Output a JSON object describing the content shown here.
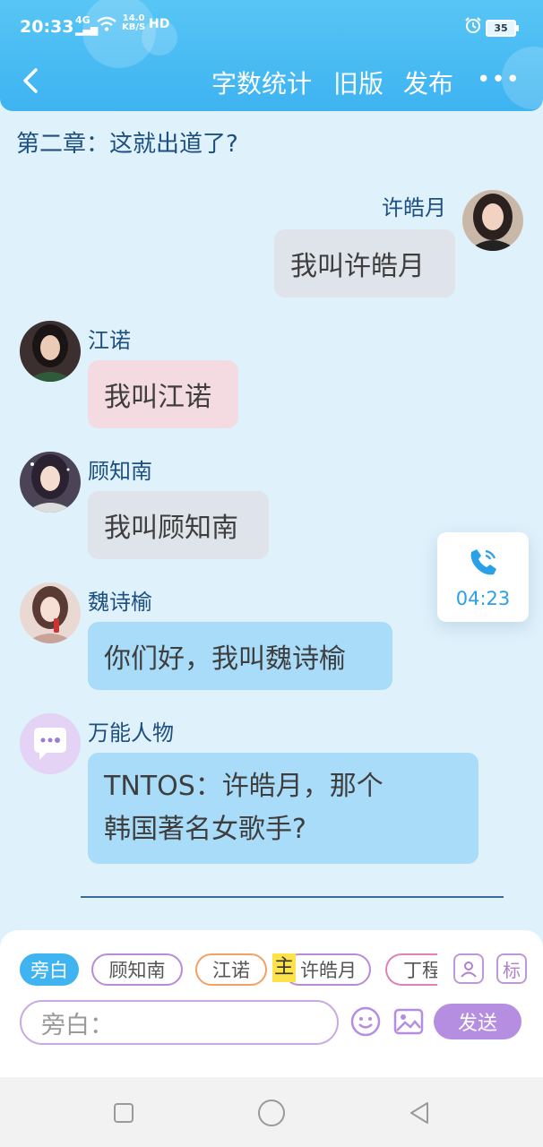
{
  "status_bar": {
    "time": "20:33",
    "signal": "4G",
    "speed_value": "14.0",
    "speed_unit": "KB/S",
    "hd": "HD",
    "battery": "35"
  },
  "header": {
    "back_icon": "chevron-left-icon",
    "actions": [
      "字数统计",
      "旧版",
      "发布"
    ],
    "more": "•••"
  },
  "chapter_title": "第二章：这就出道了?",
  "messages": [
    {
      "sender": "许皓月",
      "text": "我叫许皓月",
      "side": "right",
      "bubble_color": "#dfe3ea"
    },
    {
      "sender": "江诺",
      "text": "我叫江诺",
      "side": "left",
      "bubble_color": "#f3dbe1"
    },
    {
      "sender": "顾知南",
      "text": "我叫顾知南",
      "side": "left",
      "bubble_color": "#dfe3ea"
    },
    {
      "sender": "魏诗榆",
      "text": "你们好，我叫魏诗榆",
      "side": "left",
      "bubble_color": "#a9dcf8"
    },
    {
      "sender": "万能人物",
      "text_line1": "TNTOS：许皓月，那个",
      "text_line2": "韩国著名女歌手?",
      "side": "left",
      "bubble_color": "#a9dcf8"
    }
  ],
  "call_widget": {
    "icon": "phone-icon",
    "time": "04:23"
  },
  "bottom": {
    "chips": [
      "旁白",
      "顾知南",
      "江诺",
      "许皓月",
      "丁程"
    ],
    "zhu_marker": "主",
    "biao_label": "标",
    "input_placeholder": "旁白：",
    "send_label": "发送"
  },
  "colors": {
    "accent": "#3db3f1",
    "send": "#b58ee2",
    "name_text": "#1d4f80"
  }
}
